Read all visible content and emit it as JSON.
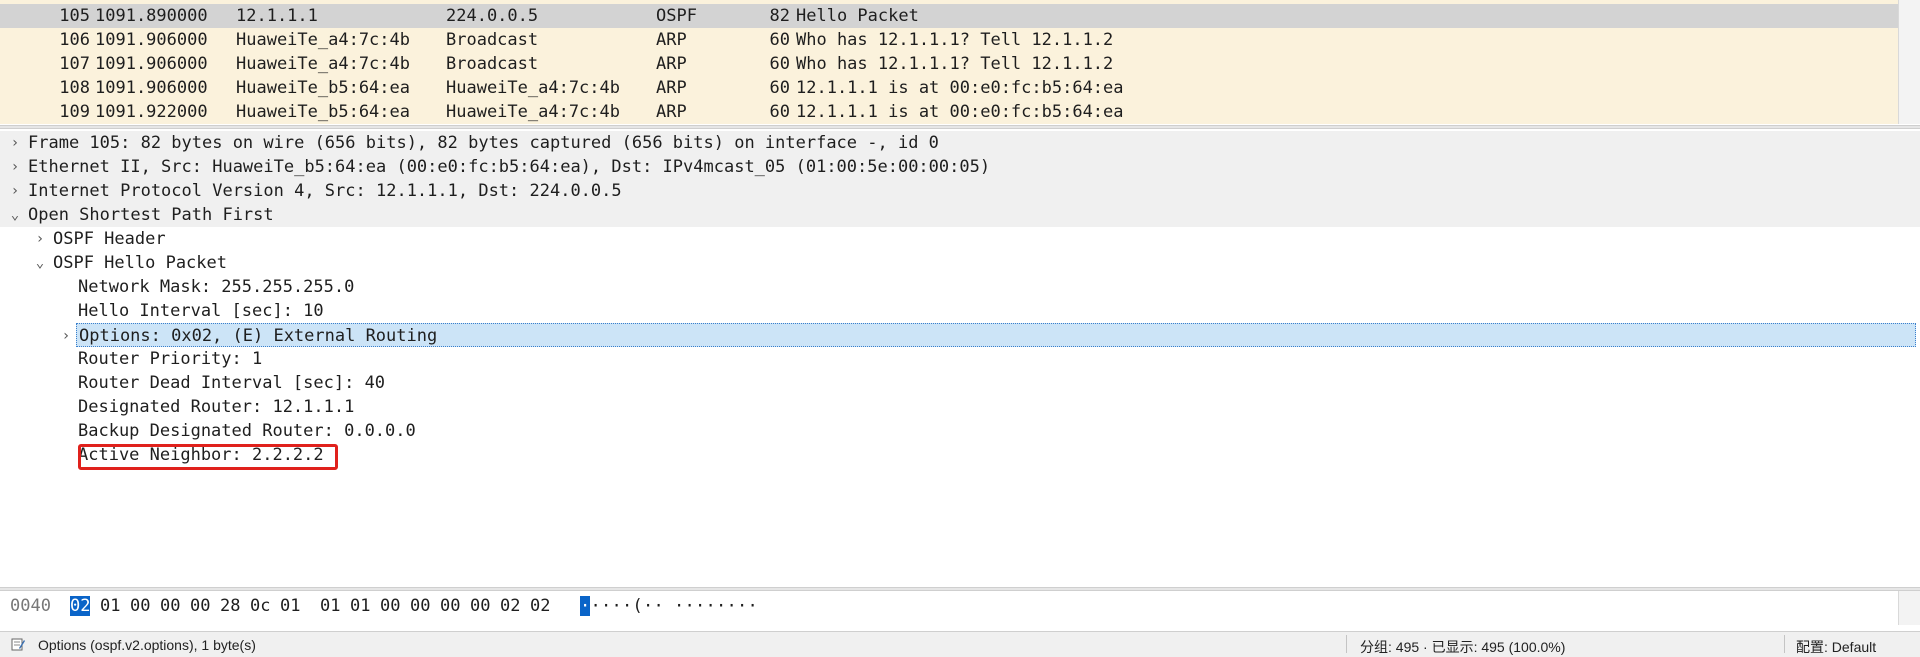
{
  "packet_list": {
    "rows": [
      {
        "no": "105",
        "time": "1091.890000",
        "src": "12.1.1.1",
        "dst": "224.0.0.5",
        "proto": "OSPF",
        "len": "82",
        "info": "Hello Packet",
        "selected": true
      },
      {
        "no": "106",
        "time": "1091.906000",
        "src": "HuaweiTe_a4:7c:4b",
        "dst": "Broadcast",
        "proto": "ARP",
        "len": "60",
        "info": "Who has 12.1.1.1? Tell 12.1.1.2",
        "selected": false
      },
      {
        "no": "107",
        "time": "1091.906000",
        "src": "HuaweiTe_a4:7c:4b",
        "dst": "Broadcast",
        "proto": "ARP",
        "len": "60",
        "info": "Who has 12.1.1.1? Tell 12.1.1.2",
        "selected": false
      },
      {
        "no": "108",
        "time": "1091.906000",
        "src": "HuaweiTe_b5:64:ea",
        "dst": "HuaweiTe_a4:7c:4b",
        "proto": "ARP",
        "len": "60",
        "info": "12.1.1.1 is at 00:e0:fc:b5:64:ea",
        "selected": false
      },
      {
        "no": "109",
        "time": "1091.922000",
        "src": "HuaweiTe_b5:64:ea",
        "dst": "HuaweiTe_a4:7c:4b",
        "proto": "ARP",
        "len": "60",
        "info": "12.1.1.1 is at 00:e0:fc:b5:64:ea",
        "selected": false
      }
    ]
  },
  "detail_tree": {
    "rows": [
      {
        "text": "Frame 105: 82 bytes on wire (656 bits), 82 bytes captured (656 bits) on interface -, id 0",
        "level": 0,
        "arrow": "›",
        "top_level": true
      },
      {
        "text": "Ethernet II, Src: HuaweiTe_b5:64:ea (00:e0:fc:b5:64:ea), Dst: IPv4mcast_05 (01:00:5e:00:00:05)",
        "level": 0,
        "arrow": "›",
        "top_level": true
      },
      {
        "text": "Internet Protocol Version 4, Src: 12.1.1.1, Dst: 224.0.0.5",
        "level": 0,
        "arrow": "›",
        "top_level": true
      },
      {
        "text": "Open Shortest Path First",
        "level": 0,
        "arrow": "⌄",
        "top_level": true
      },
      {
        "text": "OSPF Header",
        "level": 1,
        "arrow": "›"
      },
      {
        "text": "OSPF Hello Packet",
        "level": 1,
        "arrow": "⌄"
      },
      {
        "text": "Network Mask: 255.255.255.0",
        "level": 2,
        "arrow": ""
      },
      {
        "text": "Hello Interval [sec]: 10",
        "level": 2,
        "arrow": ""
      },
      {
        "text": "Options: 0x02, (E) External Routing",
        "level": 2,
        "arrow": "›",
        "selected": true
      },
      {
        "text": "Router Priority: 1",
        "level": 2,
        "arrow": ""
      },
      {
        "text": "Router Dead Interval [sec]: 40",
        "level": 2,
        "arrow": ""
      },
      {
        "text": "Designated Router: 12.1.1.1",
        "level": 2,
        "arrow": ""
      },
      {
        "text": "Backup Designated Router: 0.0.0.0",
        "level": 2,
        "arrow": ""
      },
      {
        "text": "Active Neighbor: 2.2.2.2",
        "level": 2,
        "arrow": "",
        "highlighted": true
      }
    ]
  },
  "bytes_pane": {
    "offset": "0040",
    "hex": [
      "02",
      "01",
      "00",
      "00",
      "00",
      "28",
      "0c",
      "01",
      "01",
      "01",
      "00",
      "00",
      "00",
      "00",
      "02",
      "02"
    ],
    "selected_index": 0,
    "ascii": [
      "·",
      "·",
      "·",
      "·",
      "·",
      "(",
      "·",
      "·",
      "·",
      "·",
      "·",
      "·",
      "·",
      "·",
      "·",
      "·"
    ]
  },
  "status_bar": {
    "field_info": "Options (ospf.v2.options), 1 byte(s)",
    "packets": "分组: 495 · 已显示: 495 (100.0%)",
    "profile": "配置: Default"
  },
  "colors": {
    "packet_list_bg": "#fbf2dc",
    "selected_packet_bg": "#d3d3d3",
    "tree_selected_bg": "#cce4f7",
    "annotation_red": "#e0211c",
    "byte_selected_bg": "#0a64c8"
  }
}
